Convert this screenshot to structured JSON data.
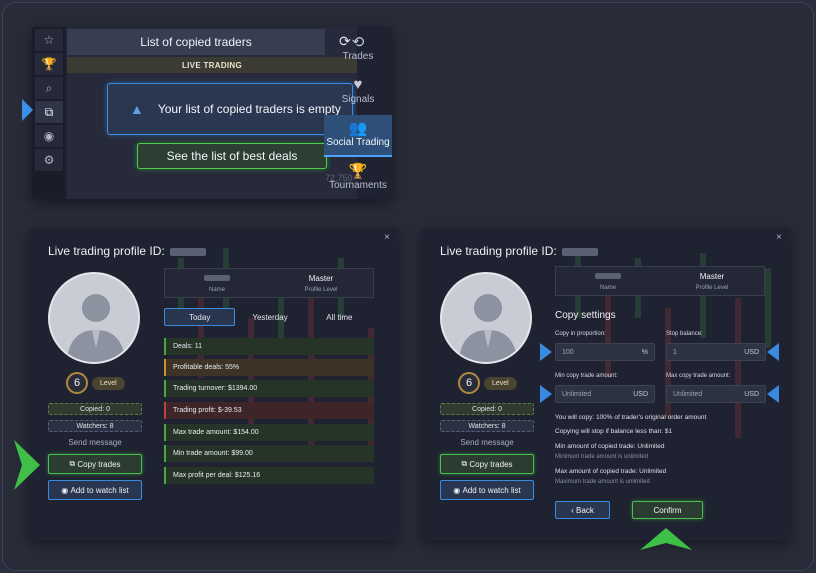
{
  "panel1": {
    "sidebar_icons": [
      "star-icon",
      "trophy-icon",
      "search-icon",
      "copy-icon",
      "eye-icon",
      "gear-icon"
    ],
    "title": "List of copied traders",
    "live_label": "LIVE TRADING",
    "empty_message": "Your list of copied traders is empty",
    "deals_button": "See the list of best deals",
    "faint_number": "72.750",
    "nav": [
      {
        "label": "Trades",
        "icon": "history-icon"
      },
      {
        "label": "Signals",
        "icon": "heartbeat-icon"
      },
      {
        "label": "Social Trading",
        "icon": "users-icon"
      },
      {
        "label": "Tournaments",
        "icon": "trophy-icon"
      }
    ]
  },
  "profile": {
    "title": "Live trading profile ID:",
    "name_label": "Name",
    "level_value": "Master",
    "level_label": "Profile Level",
    "level_number": "6",
    "level_word": "Level",
    "copied": "Copied: 0",
    "watchers": "Watchers: 8",
    "send_message": "Send message",
    "copy_trades": "Copy trades",
    "add_watch": "Add to watch list",
    "close": "×"
  },
  "tabs": [
    "Today",
    "Yesterday",
    "All time"
  ],
  "stats": [
    {
      "text": "Deals: 11",
      "tone": "green"
    },
    {
      "text": "Profitable deals: 55%",
      "tone": "orange"
    },
    {
      "text": "Trading turnover: $1394.00",
      "tone": "green"
    },
    {
      "text": "Trading profit: $-39.53",
      "tone": "red"
    },
    {
      "text": "Max trade amount: $154.00",
      "tone": "green"
    },
    {
      "text": "Min trade amount: $99.00",
      "tone": "green"
    },
    {
      "text": "Max profit per deal: $125.16",
      "tone": "green"
    }
  ],
  "copy_settings": {
    "title": "Copy settings",
    "proportion_label": "Copy in proportion:",
    "proportion_value": "100",
    "proportion_unit": "%",
    "stop_label": "Stop balance:",
    "stop_value": "1",
    "stop_unit": "USD",
    "min_label": "Min copy trade amount:",
    "min_value": "Unlimited",
    "min_unit": "USD",
    "max_label": "Max copy trade amount:",
    "max_value": "Unlimited",
    "max_unit": "USD",
    "line1": "You will copy: 100% of trader's original order amount",
    "line2": "Copying will stop if balance less than: $1",
    "line3": "Min amount of copied trade: Unlimited",
    "line3_sub": "Minimum trade amount is unlimited",
    "line4": "Max amount of copied trade: Unlimited",
    "line4_sub": "Maximum trade amount is unlimited",
    "back": "‹ Back",
    "confirm": "Confirm"
  },
  "colors": {
    "accent_blue": "#3b8ae2",
    "accent_green": "#48c04a",
    "panel_bg": "#1f2230"
  }
}
